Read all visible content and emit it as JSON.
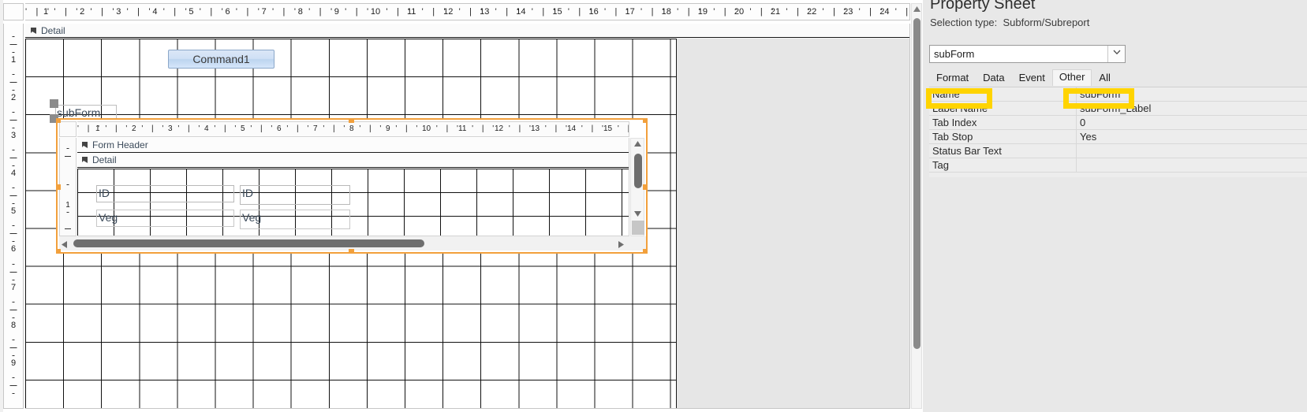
{
  "app": {
    "surface": "Access Form Design View"
  },
  "designer": {
    "section_label": "Detail",
    "section_arrow_icon": "section-collapse-arrow-icon",
    "h_ruler_numbers": [
      "1",
      "2",
      "3",
      "4",
      "5",
      "6",
      "7",
      "8",
      "9",
      "10",
      "11",
      "12",
      "13",
      "14",
      "15",
      "16",
      "17",
      "18",
      "19",
      "20",
      "21",
      "22",
      "23",
      "24"
    ],
    "h_ruler_tick_pattern": "' | '",
    "v_ruler_numbers": [
      "1",
      "2",
      "3",
      "4",
      "5",
      "6",
      "7",
      "8",
      "9"
    ],
    "command_button": {
      "label": "Command1"
    },
    "subform_label": {
      "text": "subForm"
    },
    "subform": {
      "form_header_label": "Form Header",
      "detail_label": "Detail",
      "h_ruler_numbers": [
        "1",
        "2",
        "3",
        "4",
        "5",
        "6",
        "7",
        "8",
        "9",
        "10",
        "11",
        "12",
        "13",
        "14",
        "15"
      ],
      "v_ruler_numbers": [
        "1"
      ],
      "fields": [
        {
          "label": "ID",
          "value": "ID"
        },
        {
          "label": "Veg",
          "value": "Veg"
        }
      ],
      "selection_color": "#f2a03c",
      "vscroll_up_icon": "triangle-up-icon",
      "vscroll_down_icon": "triangle-down-icon",
      "hscroll_left_icon": "triangle-left-icon",
      "hscroll_right_icon": "triangle-right-icon"
    },
    "main_scroll_up_icon": "triangle-up-icon",
    "main_scroll_down_icon": "triangle-down-icon"
  },
  "property_sheet": {
    "title": "Property Sheet",
    "selection_type_label": "Selection type:",
    "selection_type_value": "Subform/Subreport",
    "object_combo": {
      "value": "subForm",
      "dropdown_icon": "chevron-down-icon"
    },
    "tabs": [
      {
        "label": "Format",
        "active": false
      },
      {
        "label": "Data",
        "active": false
      },
      {
        "label": "Event",
        "active": false
      },
      {
        "label": "Other",
        "active": true
      },
      {
        "label": "All",
        "active": false
      }
    ],
    "rows": [
      {
        "key": "Name",
        "value": "subForm"
      },
      {
        "key": "Label Name",
        "value": "subForm_Label"
      },
      {
        "key": "Tab Index",
        "value": "0"
      },
      {
        "key": "Tab Stop",
        "value": "Yes"
      },
      {
        "key": "Status Bar Text",
        "value": ""
      },
      {
        "key": "Tag",
        "value": ""
      }
    ],
    "highlight_color": "#ffd400"
  }
}
